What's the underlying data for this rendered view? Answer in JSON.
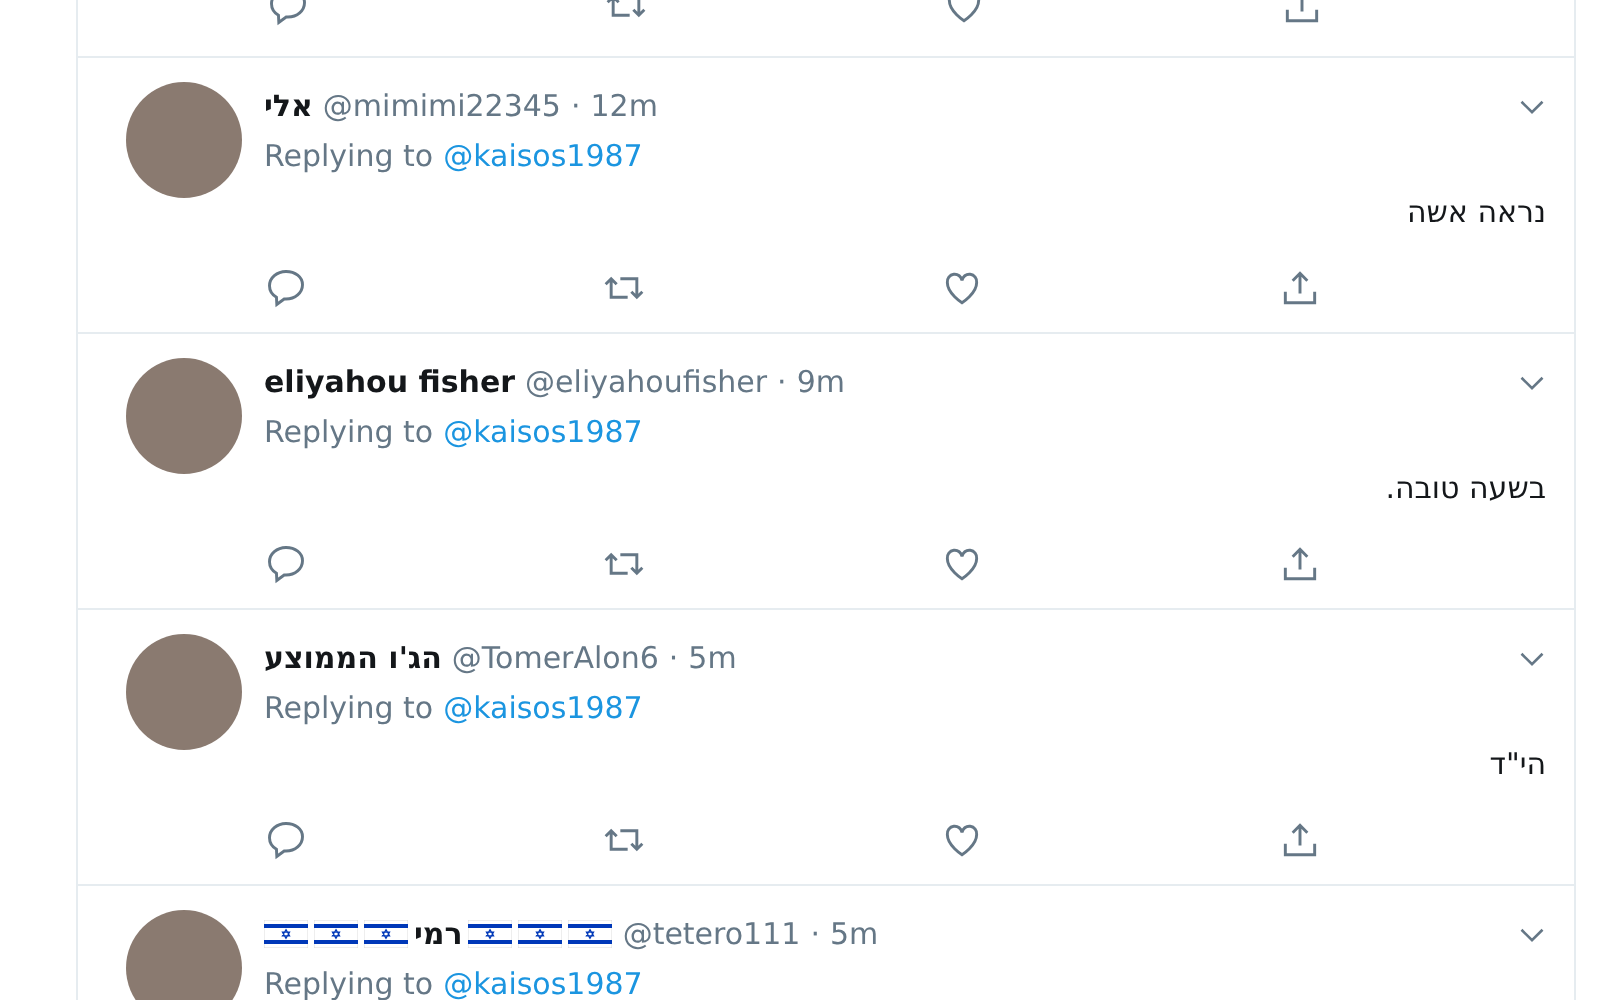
{
  "tweets": [
    {
      "name_parts": [
        {
          "kind": "text",
          "text": "אלי"
        }
      ],
      "handle": "@mimimi22345",
      "separator": "·",
      "time": "12m",
      "replying_label": "Replying to",
      "replying_to": "@kaisos1987",
      "text": "נראה אשה"
    },
    {
      "name_parts": [
        {
          "kind": "text",
          "text": "eliyahou fisher"
        }
      ],
      "handle": "@eliyahoufisher",
      "separator": "·",
      "time": "9m",
      "replying_label": "Replying to",
      "replying_to": "@kaisos1987",
      "text": "בשעה טובה."
    },
    {
      "name_parts": [
        {
          "kind": "text",
          "text": "הג'ו הממוצע"
        }
      ],
      "handle": "@TomerAlon6",
      "separator": "·",
      "time": "5m",
      "replying_label": "Replying to",
      "replying_to": "@kaisos1987",
      "text": "הי\"ד"
    },
    {
      "name_parts": [
        {
          "kind": "flag"
        },
        {
          "kind": "flag"
        },
        {
          "kind": "flag"
        },
        {
          "kind": "text",
          "text": "רמי"
        },
        {
          "kind": "flag"
        },
        {
          "kind": "flag"
        },
        {
          "kind": "flag"
        }
      ],
      "handle": "@tetero111",
      "separator": "·",
      "time": "5m",
      "replying_label": "Replying to",
      "replying_to": "@kaisos1987"
    }
  ]
}
